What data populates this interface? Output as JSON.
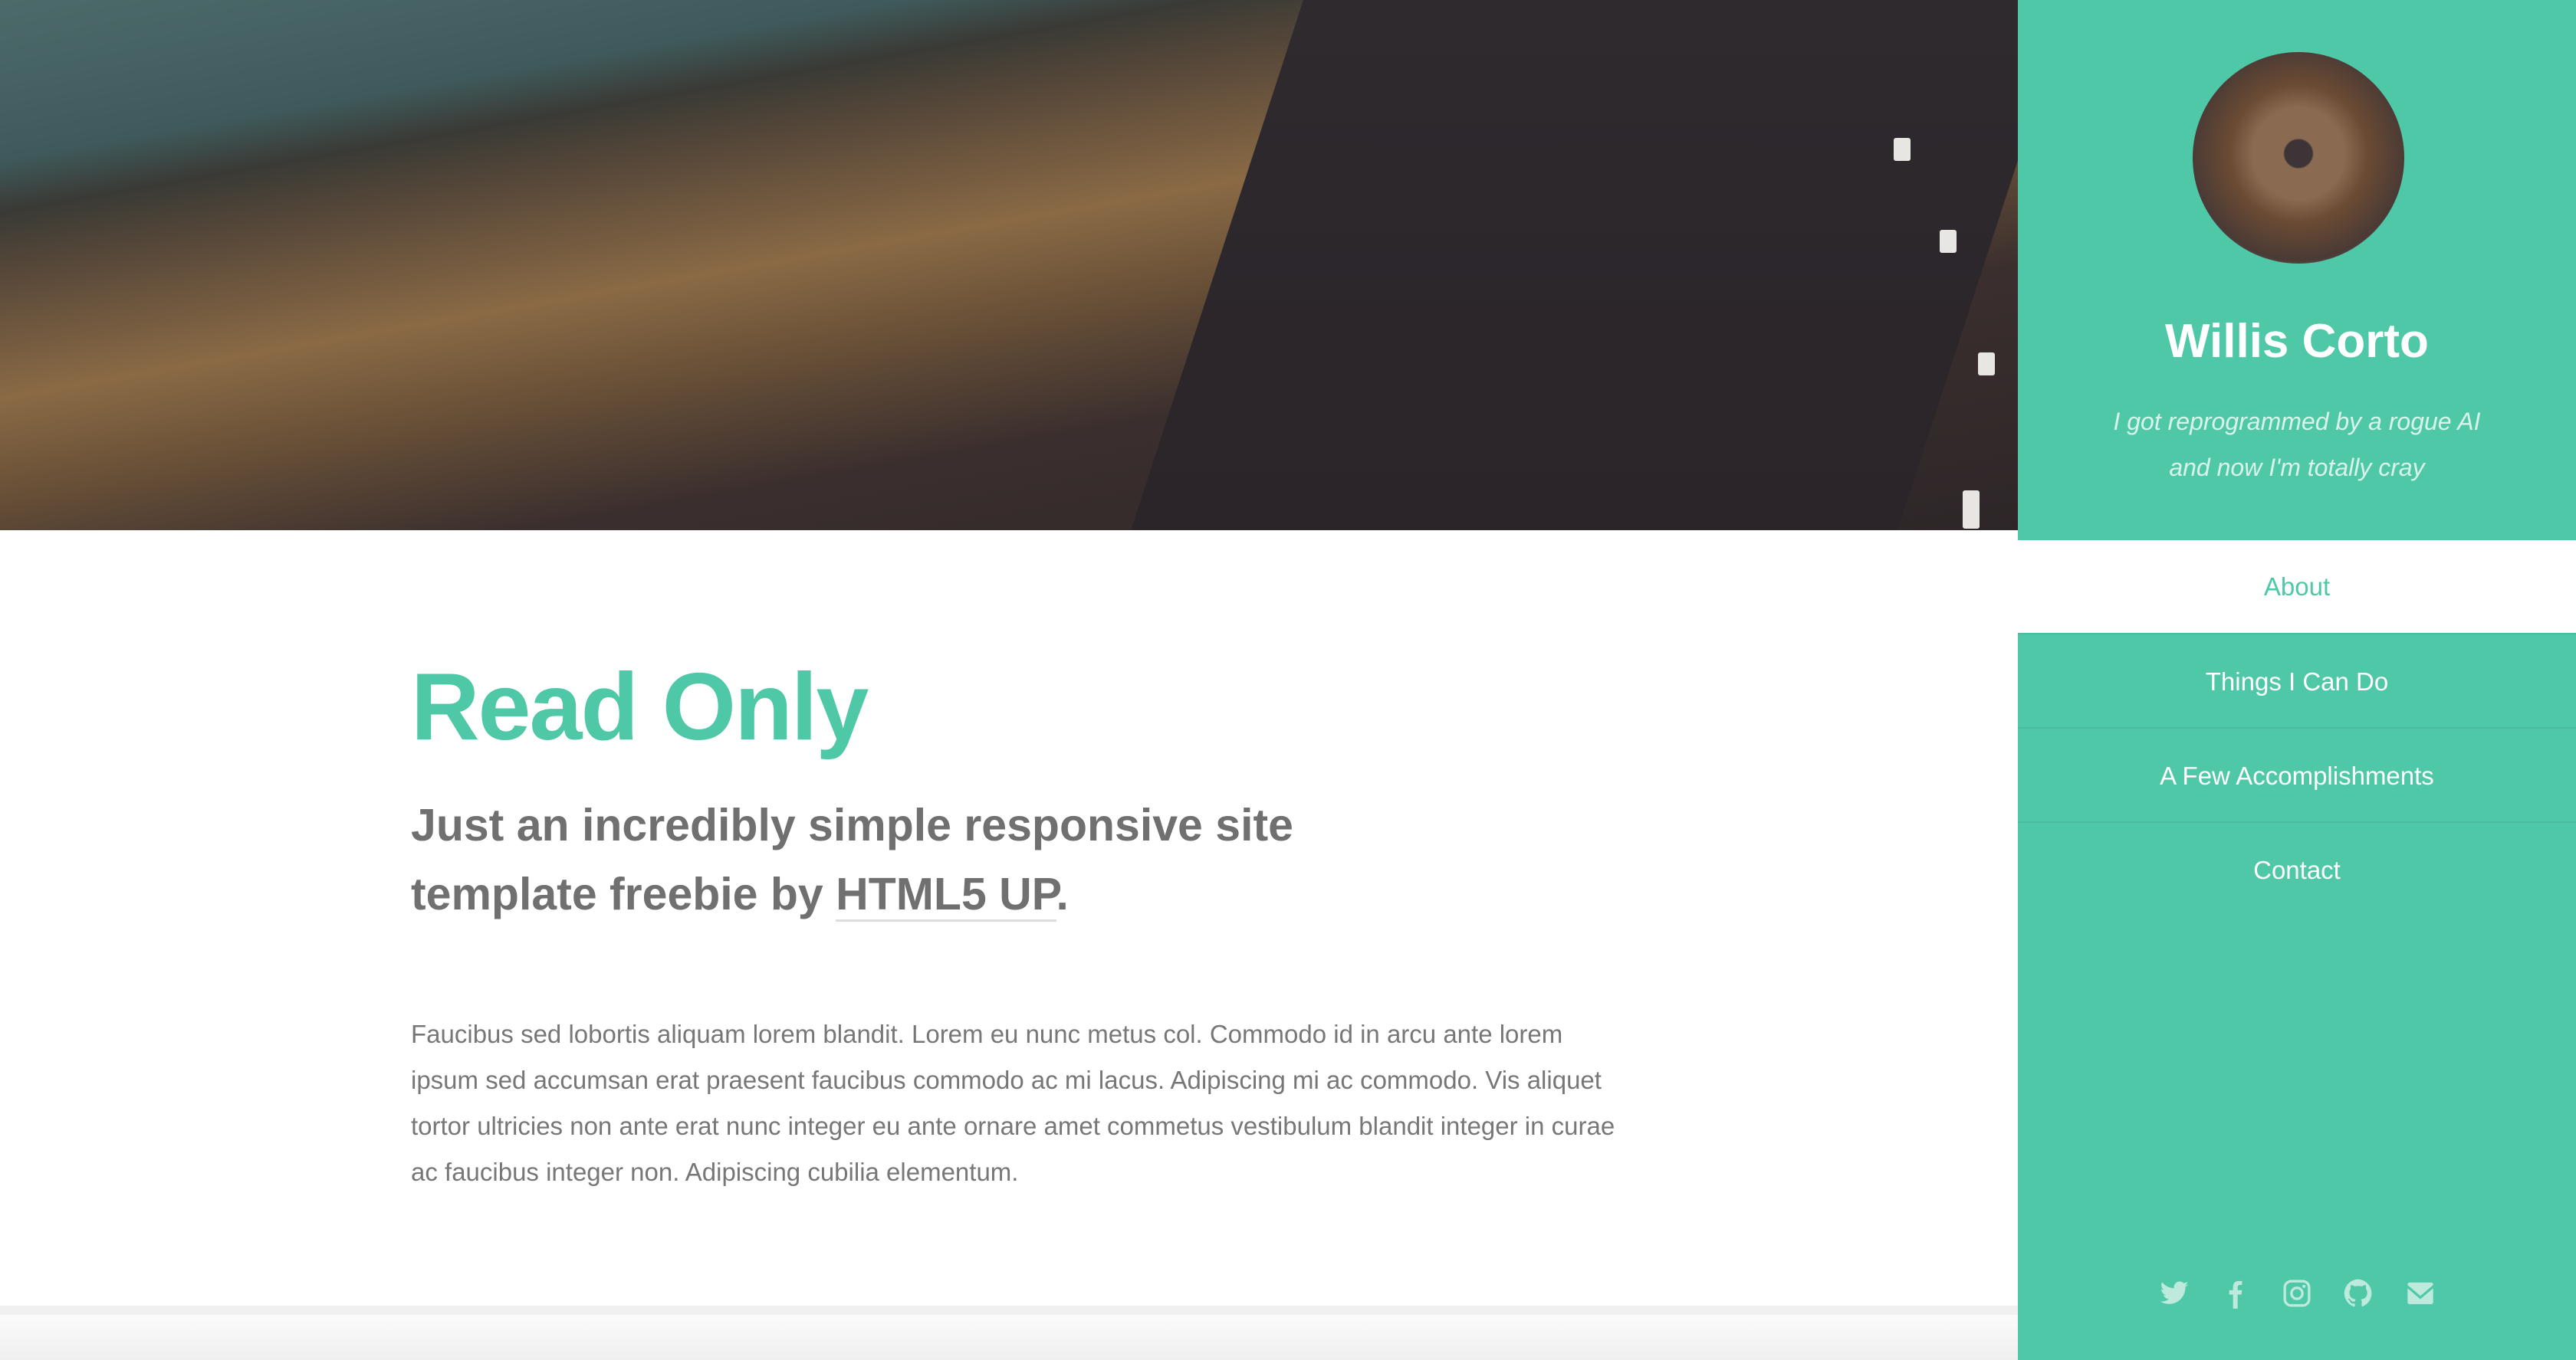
{
  "sidebar": {
    "name": "Willis Corto",
    "tagline_line1": "I got reprogrammed by a rogue AI",
    "tagline_line2": "and now I'm totally cray",
    "nav": [
      {
        "label": "About",
        "active": true
      },
      {
        "label": "Things I Can Do"
      },
      {
        "label": "A Few Accomplishments"
      },
      {
        "label": "Contact"
      }
    ],
    "social": [
      "twitter-icon",
      "facebook-icon",
      "instagram-icon",
      "github-icon",
      "envelope-icon"
    ]
  },
  "main": {
    "title": "Read Only",
    "subtitle_pre": "Just an incredibly simple responsive site template freebie by ",
    "subtitle_link": "HTML5 UP",
    "subtitle_post": ".",
    "body": "Faucibus sed lobortis aliquam lorem blandit. Lorem eu nunc metus col. Commodo id in arcu ante lorem ipsum sed accumsan erat praesent faucibus commodo ac mi lacus. Adipiscing mi ac commodo. Vis aliquet tortor ultricies non ante erat nunc integer eu ante ornare amet commetus vestibulum blandit integer in curae ac faucibus integer non. Adipiscing cubilia elementum."
  },
  "colors": {
    "accent": "#4fc8a8",
    "text": "#777777"
  }
}
